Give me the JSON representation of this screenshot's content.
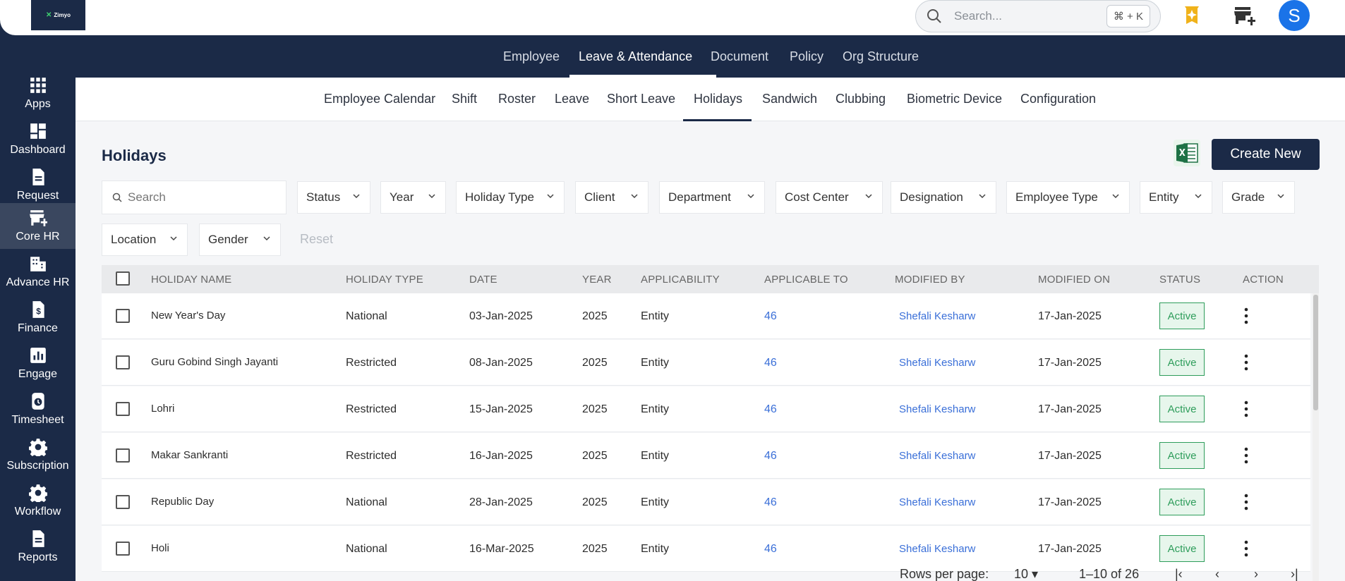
{
  "app": {
    "logo_text": "Zimyo"
  },
  "topbar": {
    "search_placeholder": "Search...",
    "shortcut": "⌘ + K",
    "avatar_initial": "S"
  },
  "sidebar": {
    "items": [
      {
        "label": "Apps",
        "icon": "grid-icon"
      },
      {
        "label": "Dashboard",
        "icon": "dashboard-icon"
      },
      {
        "label": "Request",
        "icon": "document-icon"
      },
      {
        "label": "Core HR",
        "icon": "store-add-icon",
        "active": true
      },
      {
        "label": "Advance HR",
        "icon": "building-icon"
      },
      {
        "label": "Finance",
        "icon": "dollar-document-icon"
      },
      {
        "label": "Engage",
        "icon": "bar-chart-icon"
      },
      {
        "label": "Timesheet",
        "icon": "timer-icon"
      },
      {
        "label": "Subscription",
        "icon": "gear-icon"
      },
      {
        "label": "Workflow",
        "icon": "gear-icon"
      },
      {
        "label": "Reports",
        "icon": "document-icon"
      }
    ]
  },
  "topnav": {
    "tabs": [
      "Employee",
      "Leave & Attendance",
      "Document",
      "Policy",
      "Org Structure"
    ],
    "active": "Leave & Attendance"
  },
  "subnav": {
    "tabs": [
      "Employee Calendar",
      "Shift",
      "Roster",
      "Leave",
      "Short Leave",
      "Holidays",
      "Sandwich",
      "Clubbing",
      "Biometric Device",
      "Configuration"
    ],
    "active": "Holidays"
  },
  "page": {
    "title": "Holidays",
    "create_label": "Create New",
    "excel_icon": "excel-icon"
  },
  "filters": {
    "search_placeholder": "Search",
    "items": [
      "Status",
      "Year",
      "Holiday Type",
      "Client",
      "Department",
      "Cost Center",
      "Designation",
      "Employee Type",
      "Entity",
      "Grade",
      "Location",
      "Gender"
    ],
    "reset_label": "Reset"
  },
  "table": {
    "columns": [
      "HOLIDAY NAME",
      "HOLIDAY TYPE",
      "DATE",
      "YEAR",
      "APPLICABILITY",
      "APPLICABLE TO",
      "MODIFIED BY",
      "MODIFIED ON",
      "STATUS",
      "ACTION"
    ],
    "rows": [
      {
        "name": "New Year's Day",
        "type": "National",
        "date": "03-Jan-2025",
        "year": "2025",
        "applicability": "Entity",
        "applicable_to": "46",
        "modified_by": "Shefali Kesharw",
        "modified_on": "17-Jan-2025",
        "status": "Active"
      },
      {
        "name": "Guru Gobind Singh Jayanti",
        "type": "Restricted",
        "date": "08-Jan-2025",
        "year": "2025",
        "applicability": "Entity",
        "applicable_to": "46",
        "modified_by": "Shefali Kesharw",
        "modified_on": "17-Jan-2025",
        "status": "Active"
      },
      {
        "name": "Lohri",
        "type": "Restricted",
        "date": "15-Jan-2025",
        "year": "2025",
        "applicability": "Entity",
        "applicable_to": "46",
        "modified_by": "Shefali Kesharw",
        "modified_on": "17-Jan-2025",
        "status": "Active"
      },
      {
        "name": "Makar Sankranti",
        "type": "Restricted",
        "date": "16-Jan-2025",
        "year": "2025",
        "applicability": "Entity",
        "applicable_to": "46",
        "modified_by": "Shefali Kesharw",
        "modified_on": "17-Jan-2025",
        "status": "Active"
      },
      {
        "name": "Republic Day",
        "type": "National",
        "date": "28-Jan-2025",
        "year": "2025",
        "applicability": "Entity",
        "applicable_to": "46",
        "modified_by": "Shefali Kesharw",
        "modified_on": "17-Jan-2025",
        "status": "Active"
      },
      {
        "name": "Holi",
        "type": "National",
        "date": "16-Mar-2025",
        "year": "2025",
        "applicability": "Entity",
        "applicable_to": "46",
        "modified_by": "Shefali Kesharw",
        "modified_on": "17-Jan-2025",
        "status": "Active"
      }
    ]
  },
  "pagination": {
    "rows_per_page_label": "Rows per page:",
    "rows_per_page": "10",
    "range": "1–10 of 26"
  },
  "colors": {
    "navy": "#1b2a47",
    "link": "#3a6fd8",
    "active_green": "#2e9d5b"
  }
}
